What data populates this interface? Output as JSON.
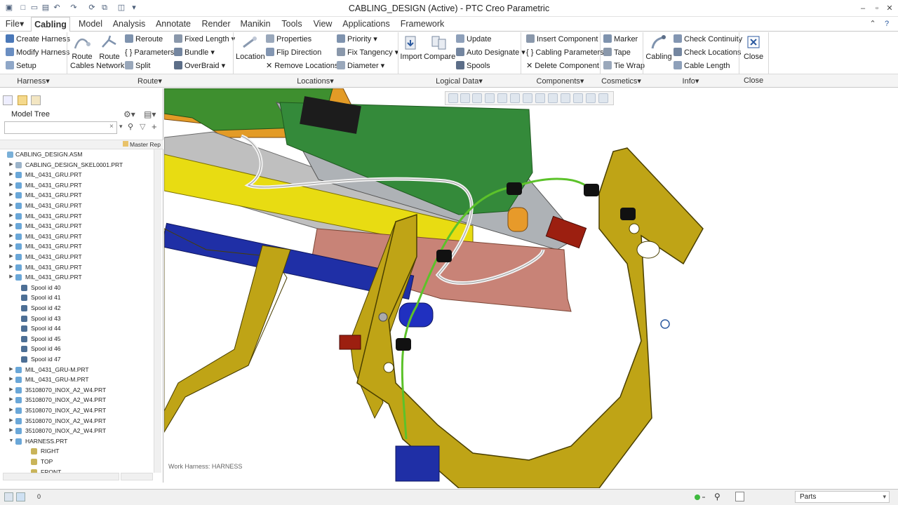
{
  "window": {
    "title": "CABLING_DESIGN (Active) - PTC Creo Parametric"
  },
  "tabs": [
    "File",
    "Cabling",
    "Model",
    "Analysis",
    "Annotate",
    "Render",
    "Manikin",
    "Tools",
    "View",
    "Applications",
    "Framework"
  ],
  "active_tab": "Cabling",
  "ribbon": {
    "harness": {
      "create": "Create Harness",
      "modify": "Modify Harness",
      "setup": "Setup"
    },
    "route": {
      "route_cables_1": "Route",
      "route_cables_2": "Cables",
      "route_network_1": "Route",
      "route_network_2": "Network",
      "reroute": "Reroute",
      "parameters": "Parameters",
      "split": "Split",
      "fixed_length": "Fixed Length",
      "bundle": "Bundle",
      "overbraid": "OverBraid"
    },
    "locations": {
      "location": "Location",
      "properties": "Properties",
      "flip_direction": "Flip Direction",
      "remove_locations": "Remove Locations",
      "priority": "Priority",
      "fix_tangency": "Fix Tangency",
      "diameter": "Diameter"
    },
    "logical": {
      "import": "Import",
      "compare": "Compare",
      "update": "Update",
      "auto_designate": "Auto Designate",
      "spools": "Spools"
    },
    "components": {
      "insert": "Insert Component",
      "cabling_parameters": "Cabling Parameters",
      "delete": "Delete Component"
    },
    "cosmetics": {
      "marker": "Marker",
      "tape": "Tape",
      "tie_wrap": "Tie Wrap"
    },
    "info": {
      "cabling": "Cabling",
      "check_continuity": "Check Continuity",
      "check_locations": "Check Locations",
      "cable_length": "Cable Length"
    },
    "close": {
      "label": "Close"
    }
  },
  "groups": [
    "Harness",
    "Route",
    "Locations",
    "Logical Data",
    "Components",
    "Cosmetics",
    "Info",
    "Close"
  ],
  "model_tree": {
    "title": "Model Tree",
    "column": "Master Rep",
    "root": "CABLING_DESIGN.ASM",
    "items": [
      {
        "label": "CABLING_DESIGN_SKEL0001.PRT",
        "kind": "skel",
        "expand": true
      },
      {
        "label": "MIL_0431_GRU.PRT",
        "kind": "part",
        "expand": true
      },
      {
        "label": "MIL_0431_GRU.PRT",
        "kind": "part",
        "expand": true
      },
      {
        "label": "MIL_0431_GRU.PRT",
        "kind": "part",
        "expand": true
      },
      {
        "label": "MIL_0431_GRU.PRT",
        "kind": "part",
        "expand": true
      },
      {
        "label": "MIL_0431_GRU.PRT",
        "kind": "part",
        "expand": true
      },
      {
        "label": "MIL_0431_GRU.PRT",
        "kind": "part",
        "expand": true
      },
      {
        "label": "MIL_0431_GRU.PRT",
        "kind": "part",
        "expand": true
      },
      {
        "label": "MIL_0431_GRU.PRT",
        "kind": "part",
        "expand": true
      },
      {
        "label": "MIL_0431_GRU.PRT",
        "kind": "part",
        "expand": true
      },
      {
        "label": "MIL_0431_GRU.PRT",
        "kind": "part",
        "expand": true
      },
      {
        "label": "MIL_0431_GRU.PRT",
        "kind": "part",
        "expand": true
      },
      {
        "label": "Spool id 40",
        "kind": "spool",
        "expand": false
      },
      {
        "label": "Spool id 41",
        "kind": "spool",
        "expand": false
      },
      {
        "label": "Spool id 42",
        "kind": "spool",
        "expand": false
      },
      {
        "label": "Spool id 43",
        "kind": "spool",
        "expand": false
      },
      {
        "label": "Spool id 44",
        "kind": "spool",
        "expand": false
      },
      {
        "label": "Spool id 45",
        "kind": "spool",
        "expand": false
      },
      {
        "label": "Spool id 46",
        "kind": "spool",
        "expand": false
      },
      {
        "label": "Spool id 47",
        "kind": "spool",
        "expand": false
      },
      {
        "label": "MIL_0431_GRU-M.PRT",
        "kind": "part",
        "expand": true
      },
      {
        "label": "MIL_0431_GRU-M.PRT",
        "kind": "part",
        "expand": true
      },
      {
        "label": "35108070_INOX_A2_W4.PRT",
        "kind": "part",
        "expand": true
      },
      {
        "label": "35108070_INOX_A2_W4.PRT",
        "kind": "part",
        "expand": true
      },
      {
        "label": "35108070_INOX_A2_W4.PRT",
        "kind": "part",
        "expand": true
      },
      {
        "label": "35108070_INOX_A2_W4.PRT",
        "kind": "part",
        "expand": true
      },
      {
        "label": "35108070_INOX_A2_W4.PRT",
        "kind": "part",
        "expand": true
      },
      {
        "label": "HARNESS.PRT",
        "kind": "harness",
        "expand": "open"
      },
      {
        "label": "RIGHT",
        "kind": "plane",
        "expand": false
      },
      {
        "label": "TOP",
        "kind": "plane",
        "expand": false
      },
      {
        "label": "FRONT",
        "kind": "plane",
        "expand": false
      }
    ]
  },
  "viewport": {
    "harness_label": "Work Harness: HARNESS"
  },
  "statusbar": {
    "count": "0",
    "filter": "Parts"
  },
  "colors": {
    "accent": "#2c5aa0",
    "plate": "#b9a30c",
    "board": "#2f8a3c",
    "cable": "#5cc22a",
    "tube": "#1f2fa6",
    "red": "#9c1f10",
    "salmon": "#c88377"
  }
}
